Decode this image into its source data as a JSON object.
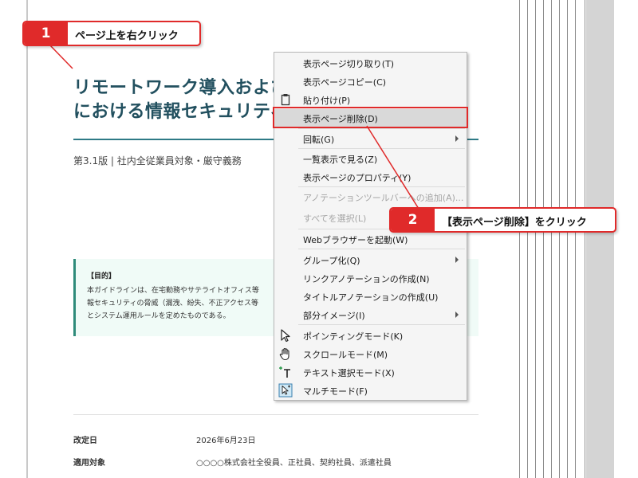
{
  "document": {
    "title_line1": "リモートワーク導入および",
    "title_line2": "における情報セキュリティ",
    "version": "第3.1版 | 社内全従業員対象・厳守義務",
    "purpose": {
      "heading": "【目的】",
      "line1": "本ガイドラインは、在宅勤務やサテライトオフィス等",
      "line2": "報セキュリティの脅威（漏洩、紛失、不正アクセス等",
      "line3": "とシステム運用ルールを定めたものである。"
    },
    "meta": [
      {
        "label": "改定日",
        "value": "2026年6月23日"
      },
      {
        "label": "適用対象",
        "value": "○○○○株式会社全役員、正社員、契約社員、派遣社員"
      }
    ]
  },
  "menu": {
    "items": [
      {
        "label": "表示ページ切り取り(T)"
      },
      {
        "label": "表示ページコピー(C)"
      },
      {
        "label": "貼り付け(P)",
        "icon": "clipboard-icon"
      },
      {
        "label": "表示ページ削除(D)",
        "highlighted": true
      },
      {
        "label": "回転(G)",
        "submenu": true
      },
      {
        "label": "一覧表示で見る(Z)"
      },
      {
        "label": "表示ページのプロパティ(Y)"
      },
      {
        "label": "アノテーションツールバーへの追加(A)...",
        "disabled": true
      },
      {
        "label": "すべてを選択(L)",
        "disabled": true
      },
      {
        "label": "Webブラウザーを起動(W)"
      },
      {
        "label": "グループ化(Q)",
        "submenu": true
      },
      {
        "label": "リンクアノテーションの作成(N)"
      },
      {
        "label": "タイトルアノテーションの作成(U)"
      },
      {
        "label": "部分イメージ(I)",
        "submenu": true
      },
      {
        "label": "ポインティングモード(K)",
        "icon": "pointer-arrow-icon"
      },
      {
        "label": "スクロールモード(M)",
        "icon": "hand-icon"
      },
      {
        "label": "テキスト選択モード(X)",
        "icon": "text-cursor-icon"
      },
      {
        "label": "マルチモード(F)",
        "icon": "multi-mode-icon"
      }
    ]
  },
  "callouts": [
    {
      "number": "1",
      "text": "ページ上を右クリック"
    },
    {
      "number": "2",
      "text": "【表示ページ削除】をクリック"
    }
  ],
  "colors": {
    "accent_red": "#e02a2a",
    "title_teal": "#22505f",
    "rule_teal": "#2e7a86",
    "purpose_bg": "#f0fbf7",
    "menu_highlight": "#d9d9d9"
  }
}
